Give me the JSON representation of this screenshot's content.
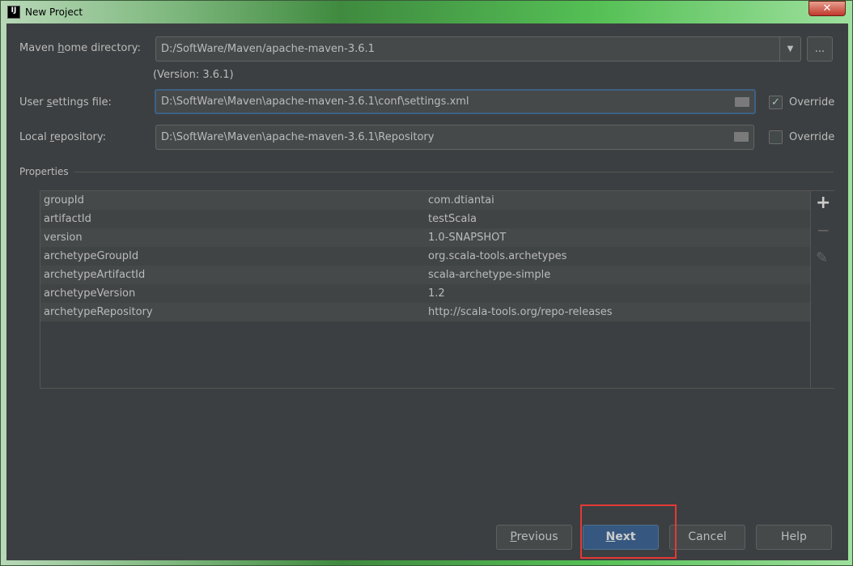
{
  "window": {
    "title": "New Project",
    "logo": "IJ",
    "close": "✕"
  },
  "maven_home": {
    "label_pre": "Maven ",
    "label_u": "h",
    "label_post": "ome directory:",
    "value": "D:/SoftWare/Maven/apache-maven-3.6.1",
    "version": "(Version: 3.6.1)",
    "browse": "..."
  },
  "user_settings": {
    "label_pre": "User ",
    "label_u": "s",
    "label_post": "ettings file:",
    "value": "D:\\SoftWare\\Maven\\apache-maven-3.6.1\\conf\\settings.xml",
    "override_label": "Override",
    "override_checked": true
  },
  "local_repo": {
    "label_pre": "Local ",
    "label_u": "r",
    "label_post": "epository:",
    "value": "D:\\SoftWare\\Maven\\apache-maven-3.6.1\\Repository",
    "override_label": "Override",
    "override_checked": false
  },
  "properties": {
    "title": "Properties",
    "rows": [
      {
        "key": "groupId",
        "value": "com.dtiantai"
      },
      {
        "key": "artifactId",
        "value": "testScala"
      },
      {
        "key": "version",
        "value": "1.0-SNAPSHOT"
      },
      {
        "key": "archetypeGroupId",
        "value": "org.scala-tools.archetypes"
      },
      {
        "key": "archetypeArtifactId",
        "value": "scala-archetype-simple"
      },
      {
        "key": "archetypeVersion",
        "value": "1.2"
      },
      {
        "key": "archetypeRepository",
        "value": "http://scala-tools.org/repo-releases"
      }
    ],
    "add": "+",
    "remove": "−",
    "edit": "✎"
  },
  "buttons": {
    "previous_u": "P",
    "previous_rest": "revious",
    "next_u": "N",
    "next_rest": "ext",
    "cancel": "Cancel",
    "help": "Help"
  },
  "highlight_color": "#e53935"
}
